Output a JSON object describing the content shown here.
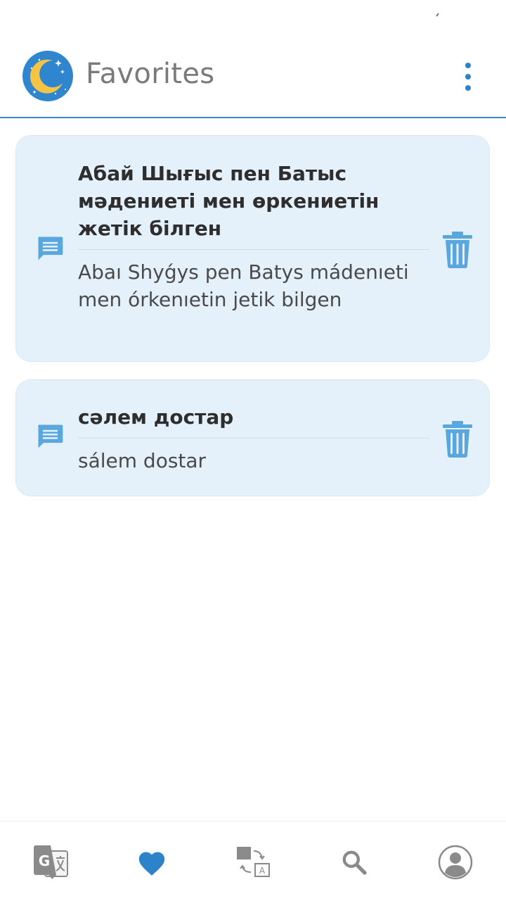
{
  "header": {
    "title": "Favorites",
    "logo": "crescent-moon-stars-logo",
    "menu_icon": "more-vertical-icon"
  },
  "favorites": [
    {
      "source": "Абай Шығыс пен Батыс мәдениеті мен өркениетін жетік білген",
      "transliteration": "Abaı Shyǵys pen Batys mádenıeti men órkenıetin jetik bilgen",
      "icon": "chat-message-icon",
      "action_icon": "trash-icon"
    },
    {
      "source": "сәлем достар",
      "transliteration": "sálem dostar",
      "icon": "chat-message-icon",
      "action_icon": "trash-icon"
    }
  ],
  "bottom_nav": [
    {
      "name": "translate",
      "icon": "google-translate-icon",
      "active": false
    },
    {
      "name": "favorites",
      "icon": "heart-icon",
      "active": true
    },
    {
      "name": "phrases",
      "icon": "text-swap-icon",
      "active": false
    },
    {
      "name": "search",
      "icon": "search-icon",
      "active": false
    },
    {
      "name": "profile",
      "icon": "account-icon",
      "active": false
    }
  ],
  "colors": {
    "accent": "#2d83c9",
    "card_background": "#e5f1fa",
    "icon_blue": "#5aa7dd",
    "title_gray": "#7a7a7a",
    "inactive_nav": "#8a8a8a"
  }
}
